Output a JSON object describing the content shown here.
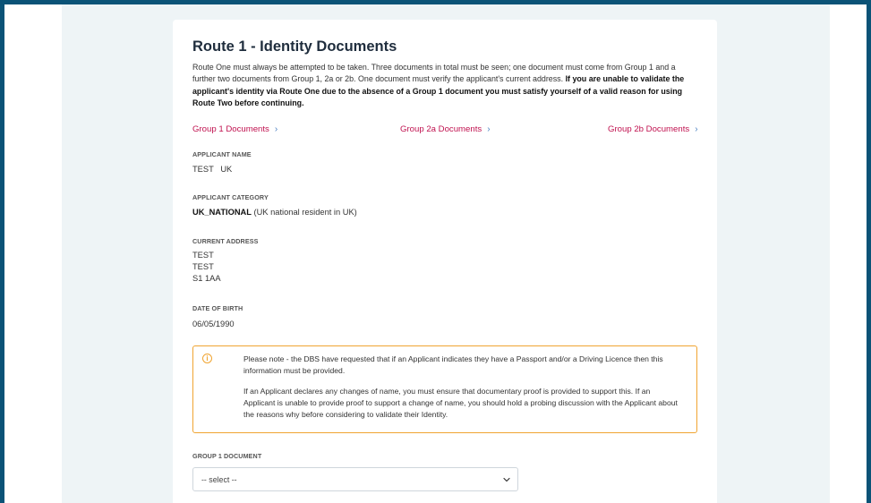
{
  "page": {
    "title": "Route 1 - Identity Documents",
    "intro_normal": "Route One must always be attempted to be taken. Three documents in total must be seen; one document must come from Group 1 and a further two documents from Group 1, 2a or 2b. One document must verify the applicant's current address. ",
    "intro_bold": "If you are unable to validate the applicant's identity via Route One due to the absence of a Group 1 document you must satisfy yourself of a valid reason for using Route Two before continuing."
  },
  "groups": [
    {
      "label": "Group 1 Documents",
      "icon": "chevron-right-icon"
    },
    {
      "label": "Group 2a Documents",
      "icon": "chevron-right-icon"
    },
    {
      "label": "Group 2b Documents",
      "icon": "chevron-right-icon"
    }
  ],
  "applicant": {
    "name_label": "APPLICANT NAME",
    "name_value": "TEST   UK",
    "category_label": "APPLICANT CATEGORY",
    "category_code": "UK_NATIONAL",
    "category_desc": " (UK national resident in UK)",
    "address_label": "CURRENT ADDRESS",
    "address_lines": [
      "TEST",
      "TEST",
      "S1 1AA"
    ],
    "dob_label": "DATE OF BIRTH",
    "dob_value": "06/05/1990"
  },
  "notice": {
    "icon": "info-icon",
    "color": "#f0a431",
    "paragraph1": "Please note - the DBS have requested that if an Applicant indicates they have a Passport and/or a Driving Licence then this information must be provided.",
    "paragraph2": "If an Applicant declares any changes of name, you must ensure that documentary proof is provided to support this. If an Applicant is unable to provide proof to support a change of name, you should hold a probing discussion with the Applicant about the reasons why before considering to validate their Identity."
  },
  "group1_select": {
    "label": "GROUP 1 DOCUMENT",
    "selected": "-- select --"
  },
  "colors": {
    "frame": "#0b5377",
    "background": "#eef4f6",
    "link": "#c0114f",
    "chevron": "#4a7fc1",
    "notice_border": "#f0a431"
  }
}
